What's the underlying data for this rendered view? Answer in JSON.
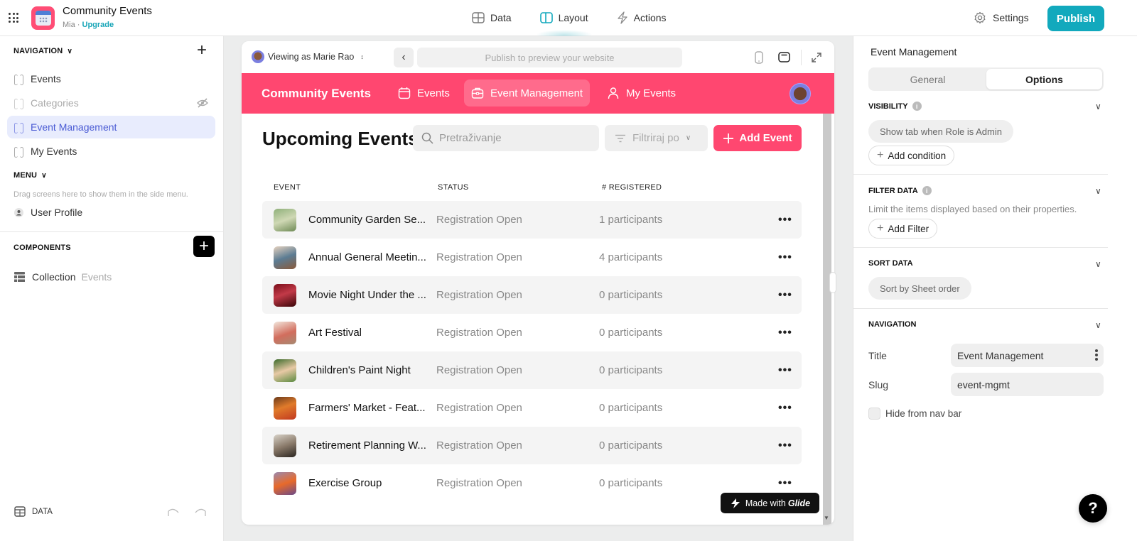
{
  "topbar": {
    "app_title": "Community Events",
    "user": "Mia",
    "separator": " · ",
    "upgrade": "Upgrade",
    "tabs": [
      {
        "label": "Data",
        "icon": "table-icon"
      },
      {
        "label": "Layout",
        "icon": "layout-icon",
        "active": true
      },
      {
        "label": "Actions",
        "icon": "lightning-icon"
      }
    ],
    "settings": "Settings",
    "publish": "Publish",
    "accent": "#12a9bd"
  },
  "left": {
    "navigation_header": "NAVIGATION",
    "nav_items": [
      {
        "label": "Events"
      },
      {
        "label": "Categories",
        "hidden": true
      },
      {
        "label": "Event Management",
        "active": true
      },
      {
        "label": "My Events"
      }
    ],
    "menu_header": "MENU",
    "menu_hint": "Drag screens here to show them in the side menu.",
    "menu_items": [
      {
        "label": "User Profile"
      }
    ],
    "components_header": "COMPONENTS",
    "components": [
      {
        "label": "Collection",
        "source": "Events"
      }
    ],
    "data_label": "DATA"
  },
  "preview": {
    "viewing_as": "Viewing as Marie Rao",
    "url_placeholder": "Publish to preview your website",
    "app_name": "Community Events",
    "app_tabs": [
      {
        "label": "Events",
        "icon": "calendar-icon"
      },
      {
        "label": "Event Management",
        "icon": "briefcase-icon",
        "active": true
      },
      {
        "label": "My Events",
        "icon": "person-icon"
      }
    ],
    "brand_color": "#ff4770",
    "page_title": "Upcoming Events",
    "search_placeholder": "Pretraživanje",
    "filter_label": "Filtriraj po",
    "add_button": "Add Event",
    "columns": [
      "EVENT",
      "STATUS",
      "# REGISTERED"
    ],
    "rows": [
      {
        "name": "Community Garden Se...",
        "status": "Registration Open",
        "registered": "1 participants"
      },
      {
        "name": "Annual General Meetin...",
        "status": "Registration Open",
        "registered": "4 participants"
      },
      {
        "name": "Movie Night Under the ...",
        "status": "Registration Open",
        "registered": "0 participants"
      },
      {
        "name": "Art Festival",
        "status": "Registration Open",
        "registered": "0 participants"
      },
      {
        "name": "Children's Paint Night",
        "status": "Registration Open",
        "registered": "0 participants"
      },
      {
        "name": "Farmers' Market - Feat...",
        "status": "Registration Open",
        "registered": "0 participants"
      },
      {
        "name": "Retirement Planning W...",
        "status": "Registration Open",
        "registered": "0 participants"
      },
      {
        "name": "Exercise Group",
        "status": "Registration Open",
        "registered": "0 participants"
      }
    ],
    "more_glyph": "•••",
    "made_with": "Made with",
    "glide": "Glide"
  },
  "right": {
    "title": "Event Management",
    "tabs": [
      {
        "label": "General"
      },
      {
        "label": "Options",
        "active": true
      }
    ],
    "visibility": {
      "header": "VISIBILITY",
      "rule": "Show tab when Role is Admin",
      "add": "Add condition"
    },
    "filter": {
      "header": "FILTER DATA",
      "desc": "Limit the items displayed based on their properties.",
      "add": "Add Filter"
    },
    "sort": {
      "header": "SORT DATA",
      "value": "Sort by Sheet order"
    },
    "navigation": {
      "header": "NAVIGATION",
      "title_label": "Title",
      "title_value": "Event Management",
      "slug_label": "Slug",
      "slug_value": "event-mgmt",
      "hide_label": "Hide from nav bar",
      "hide_checked": false
    }
  },
  "help": "?"
}
